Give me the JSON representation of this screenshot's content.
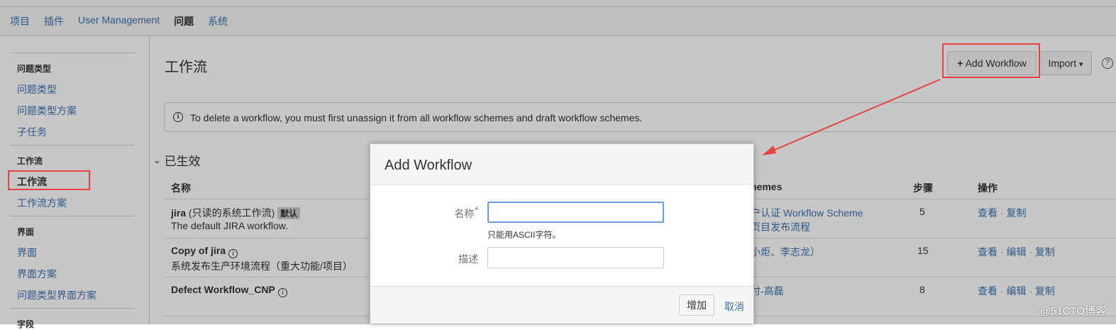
{
  "topnav": {
    "items": [
      "项目",
      "插件",
      "User Management",
      "问题",
      "系统"
    ],
    "active_index": 3
  },
  "sidebar": {
    "sections": [
      {
        "heading": "问题类型",
        "items": [
          "问题类型",
          "问题类型方案",
          "子任务"
        ]
      },
      {
        "heading": "工作流",
        "items": [
          "工作流",
          "工作流方案"
        ]
      },
      {
        "heading": "界面",
        "items": [
          "界面",
          "界面方案",
          "问题类型界面方案"
        ]
      },
      {
        "heading": "字段",
        "items": []
      }
    ],
    "active_item": "工作流"
  },
  "page": {
    "title": "工作流",
    "add_workflow_label": "Add Workflow",
    "add_workflow_plus": "+",
    "import_label": "Import",
    "import_caret": "▾",
    "help_label": "?",
    "info_icon_label": "i",
    "info_message": "To delete a workflow, you must first unassign it from all workflow schemes and draft workflow schemes.",
    "section_chevron": "⌄",
    "section_title": "已生效"
  },
  "table": {
    "headers": {
      "name": "名称",
      "schemes": "hemes",
      "steps": "步骤",
      "actions": "操作"
    },
    "rows": [
      {
        "name": "jira",
        "name_suffix": " (只读的系统工作流)",
        "badge": "默认",
        "description": "The default JIRA workflow.",
        "schemes": [
          "户认证 Workflow Scheme",
          "页目发布流程"
        ],
        "steps": "5",
        "actions": [
          "查看",
          "复制"
        ]
      },
      {
        "name": "Copy of jira",
        "info": "i",
        "description": "系统发布生产环境流程（重大功能/项目）",
        "schemes": [
          "小炬、李志龙）"
        ],
        "steps": "15",
        "actions": [
          "查看",
          "编辑",
          "复制"
        ]
      },
      {
        "name": "Defect Workflow_CNP",
        "info": "i",
        "description": "",
        "schemes": [
          "付-高磊"
        ],
        "steps": "8",
        "actions": [
          "查看",
          "编辑",
          "复制"
        ]
      }
    ],
    "action_separator": "·"
  },
  "dialog": {
    "title": "Add Workflow",
    "name_label": "名称",
    "required_mark": "*",
    "name_value": "",
    "name_hint": "只能用ASCII字符。",
    "desc_label": "描述",
    "desc_value": "",
    "submit_label": "增加",
    "cancel_label": "取消"
  },
  "watermark": "@51CTO博客",
  "colors": {
    "link": "#3b73af",
    "annotation_red": "#e94040",
    "text": "#333333"
  }
}
